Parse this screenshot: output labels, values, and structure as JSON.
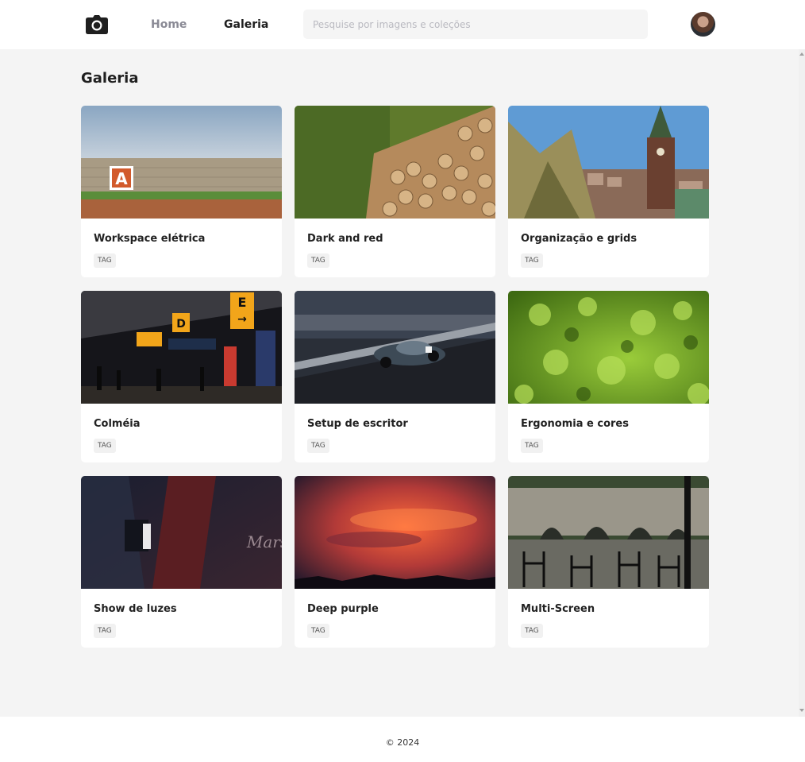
{
  "header": {
    "logo_icon": "camera-icon",
    "nav": [
      {
        "label": "Home"
      },
      {
        "label": "Galeria"
      }
    ],
    "search_placeholder": "Pesquise por imagens e coleções",
    "avatar_icon": "user-avatar"
  },
  "main": {
    "title": "Galeria",
    "cards": [
      {
        "title": "Workspace elétrica",
        "tag": "TAG",
        "image": "wall-with-letter-A-under-sky"
      },
      {
        "title": "Dark and red",
        "tag": "TAG",
        "image": "stacked-logs"
      },
      {
        "title": "Organização e grids",
        "tag": "TAG",
        "image": "church-tower-over-town"
      },
      {
        "title": "Colméia",
        "tag": "TAG",
        "image": "airport-terminal-signs"
      },
      {
        "title": "Setup de escritor",
        "tag": "TAG",
        "image": "vintage-race-car"
      },
      {
        "title": "Ergonomia e cores",
        "tag": "TAG",
        "image": "green-moss"
      },
      {
        "title": "Show de luzes",
        "tag": "TAG",
        "image": "guitar-and-amplifier"
      },
      {
        "title": "Deep purple",
        "tag": "TAG",
        "image": "red-sunset-clouds"
      },
      {
        "title": "Multi-Screen",
        "tag": "TAG",
        "image": "stone-bridge-cafe"
      }
    ]
  },
  "footer": {
    "copyright": "© 2024"
  },
  "colors": {
    "background": "#f4f4f4",
    "card": "#ffffff",
    "nav_inactive": "#8a8a95",
    "nav_active": "#1f1f1f"
  }
}
